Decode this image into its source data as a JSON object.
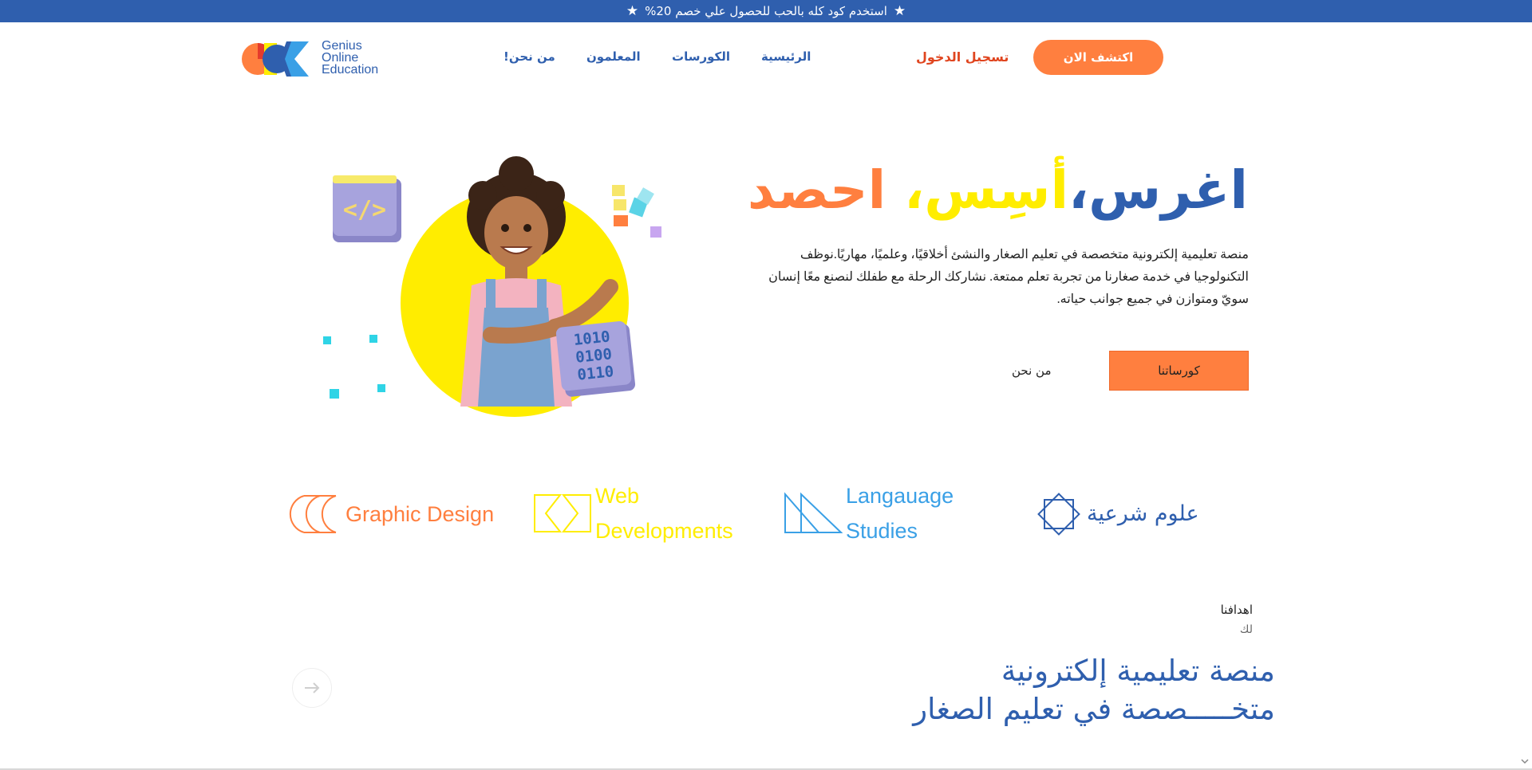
{
  "promo": {
    "text": "%استخدم كود كله بالحب للحصول علي خصم 20"
  },
  "logo": {
    "line1": "Genius",
    "line2": "Online",
    "line3": "Education"
  },
  "nav": {
    "home": "الرئيسية",
    "courses": "الكورسات",
    "teachers": "المعلمون",
    "about": "!من نحن",
    "login": "تسجيل الدخول",
    "cta": "اكتشف الان"
  },
  "hero": {
    "title_w1": "اغرس،",
    "title_w2": "أسِس،",
    "title_w3": " احصد",
    "description": "منصة تعليمية إلكترونية متخصصة في تعليم الصغار والنشئ أخلاقيًا، وعلميًا، مهاريًا.نوظف التكنولوجيا في خدمة صغارنا من تجربة تعلم ممتعة. نشاركك الرحلة مع طفلك لنصنع معًا إنسان سويّ ومتوازن في جميع جوانب حياته.",
    "btn_courses": "كورساتنا",
    "btn_about": "من نحن",
    "art_code_label": "</>",
    "art_binary": [
      "1010",
      "0100",
      "0110"
    ]
  },
  "categories": {
    "graphic": "Graphic Design",
    "web_line1": "Web",
    "web_line2": "Developments",
    "lang_line1": "Langauage",
    "lang_line2": "Studies",
    "islamic": "علوم شرعية"
  },
  "goals": {
    "kicker": "اهدافنا",
    "sub": "لك",
    "title_line1": "منصة تعليمية إلكترونية",
    "title_line2": "متخـــــصصة في تعليم الصغار"
  },
  "colors": {
    "brand_blue": "#2f5fae",
    "orange": "#ff7f3f",
    "yellow": "#ffed00",
    "light_blue": "#3aa0e6",
    "login_red": "#e0451f"
  }
}
